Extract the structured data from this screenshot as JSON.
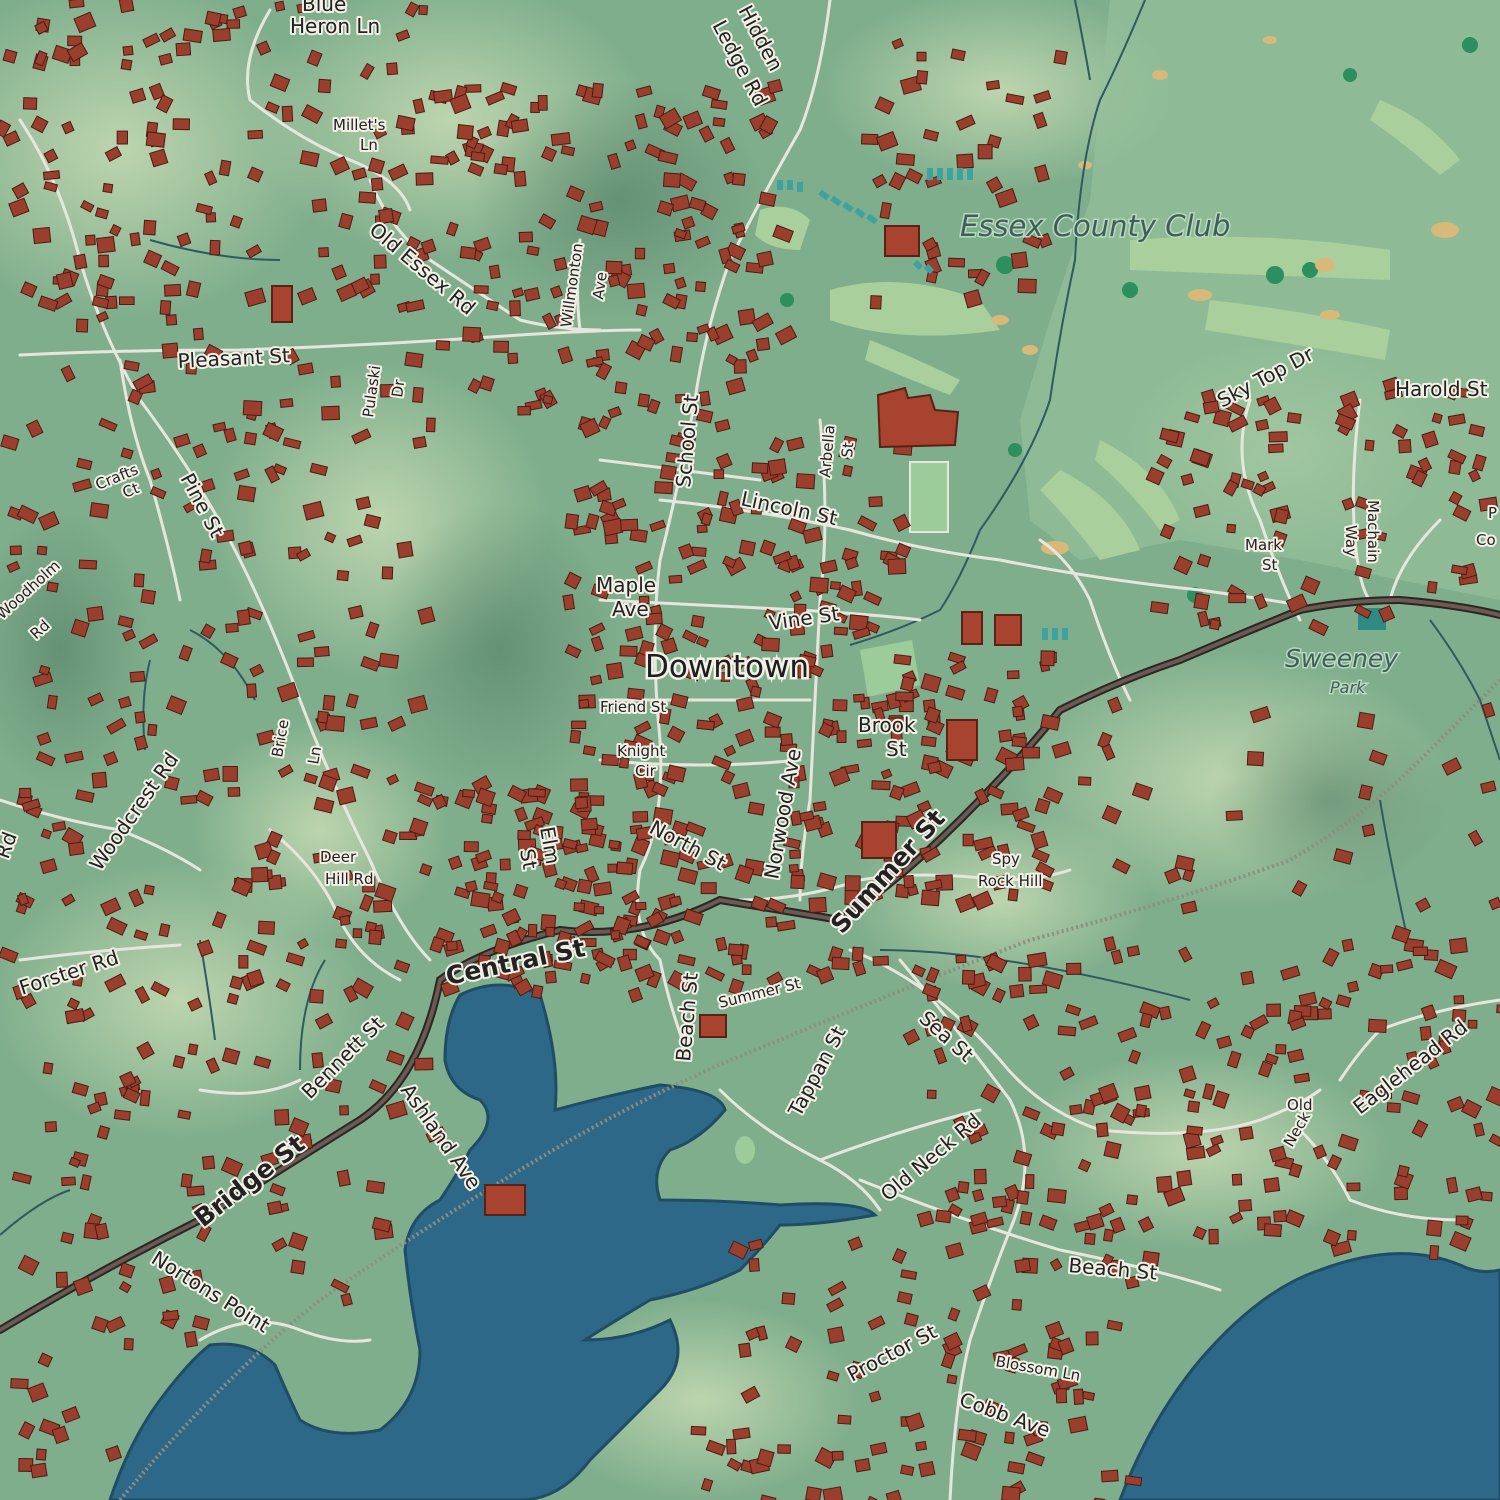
{
  "map": {
    "colors": {
      "land": "#7fae8c",
      "water": "#2e6888",
      "water_edge": "#1f4d66",
      "building": "#9a3e2d",
      "road": "#e8e6dc",
      "highway": "#4a3f3a",
      "golf": "#a8cf9c",
      "sand": "#d8b97a"
    },
    "places": {
      "downtown": "Downtown",
      "club": "Essex County Club",
      "park_name": "Sweeney",
      "park_sub": "Park"
    },
    "streets": {
      "blue_heron_1": "Blue",
      "blue_heron_2": "Heron Ln",
      "hidden_1": "Hidden",
      "hidden_2": "Ledge Rd",
      "millets_1": "Millet's",
      "millets_2": "Ln",
      "old_essex": "Old Essex Rd",
      "willmonton_1": "Willmonton",
      "willmonton_2": "Ave",
      "pleasant": "Pleasant St",
      "pulaski_1": "Pulaski",
      "pulaski_2": "Dr",
      "school": "School St",
      "arbella_1": "Arbella",
      "arbella_2": "St",
      "sky_top": "Sky Top Dr",
      "harold": "Harold St",
      "crafts_1": "Crafts",
      "crafts_2": "Ct",
      "pine": "Pine St",
      "lincoln": "Lincoln St",
      "mark_1": "Mark",
      "mark_2": "St",
      "machain_1": "Machain",
      "machain_2": "Way",
      "p_co_1": "P",
      "p_co_2": "Co",
      "woodholm_1": "Woodholm",
      "woodholm_2": "Rd",
      "maple_1": "Maple",
      "maple_2": "Ave",
      "vine": "Vine St",
      "friend": "Friend St",
      "brice_1": "Brice",
      "brice_2": "Ln",
      "woodcrest": "Woodcrest Rd",
      "brook_1": "Brook",
      "brook_2": "St",
      "knight_1": "Knight",
      "knight_2": "Cir",
      "norwood": "Norwood Ave",
      "elm_1": "Elm",
      "elm_2": "St",
      "north": "North St",
      "rd_left": "Rd",
      "deer_1": "Deer",
      "deer_2": "Hill Rd",
      "summer_main": "Summer St",
      "spy_1": "Spy",
      "spy_2": "Rock Hill",
      "central": "Central St",
      "forster": "Forster Rd",
      "beach_upper": "Beach St",
      "summer_small": "Summer St",
      "bennett": "Bennett St",
      "tappan": "Tappan St",
      "sea": "Sea St",
      "ashland": "Ashland Ave",
      "eaglehead": "Eaglehead Rd",
      "old_neck_1": "Old",
      "old_neck_2": "Neck",
      "old_neck_rd": "Old Neck Rd",
      "bridge": "Bridge St",
      "beach_lower": "Beach St",
      "nortons": "Nortons Point",
      "proctor": "Proctor St",
      "blossom": "Blossom Ln",
      "cobb": "Cobb Ave"
    }
  }
}
